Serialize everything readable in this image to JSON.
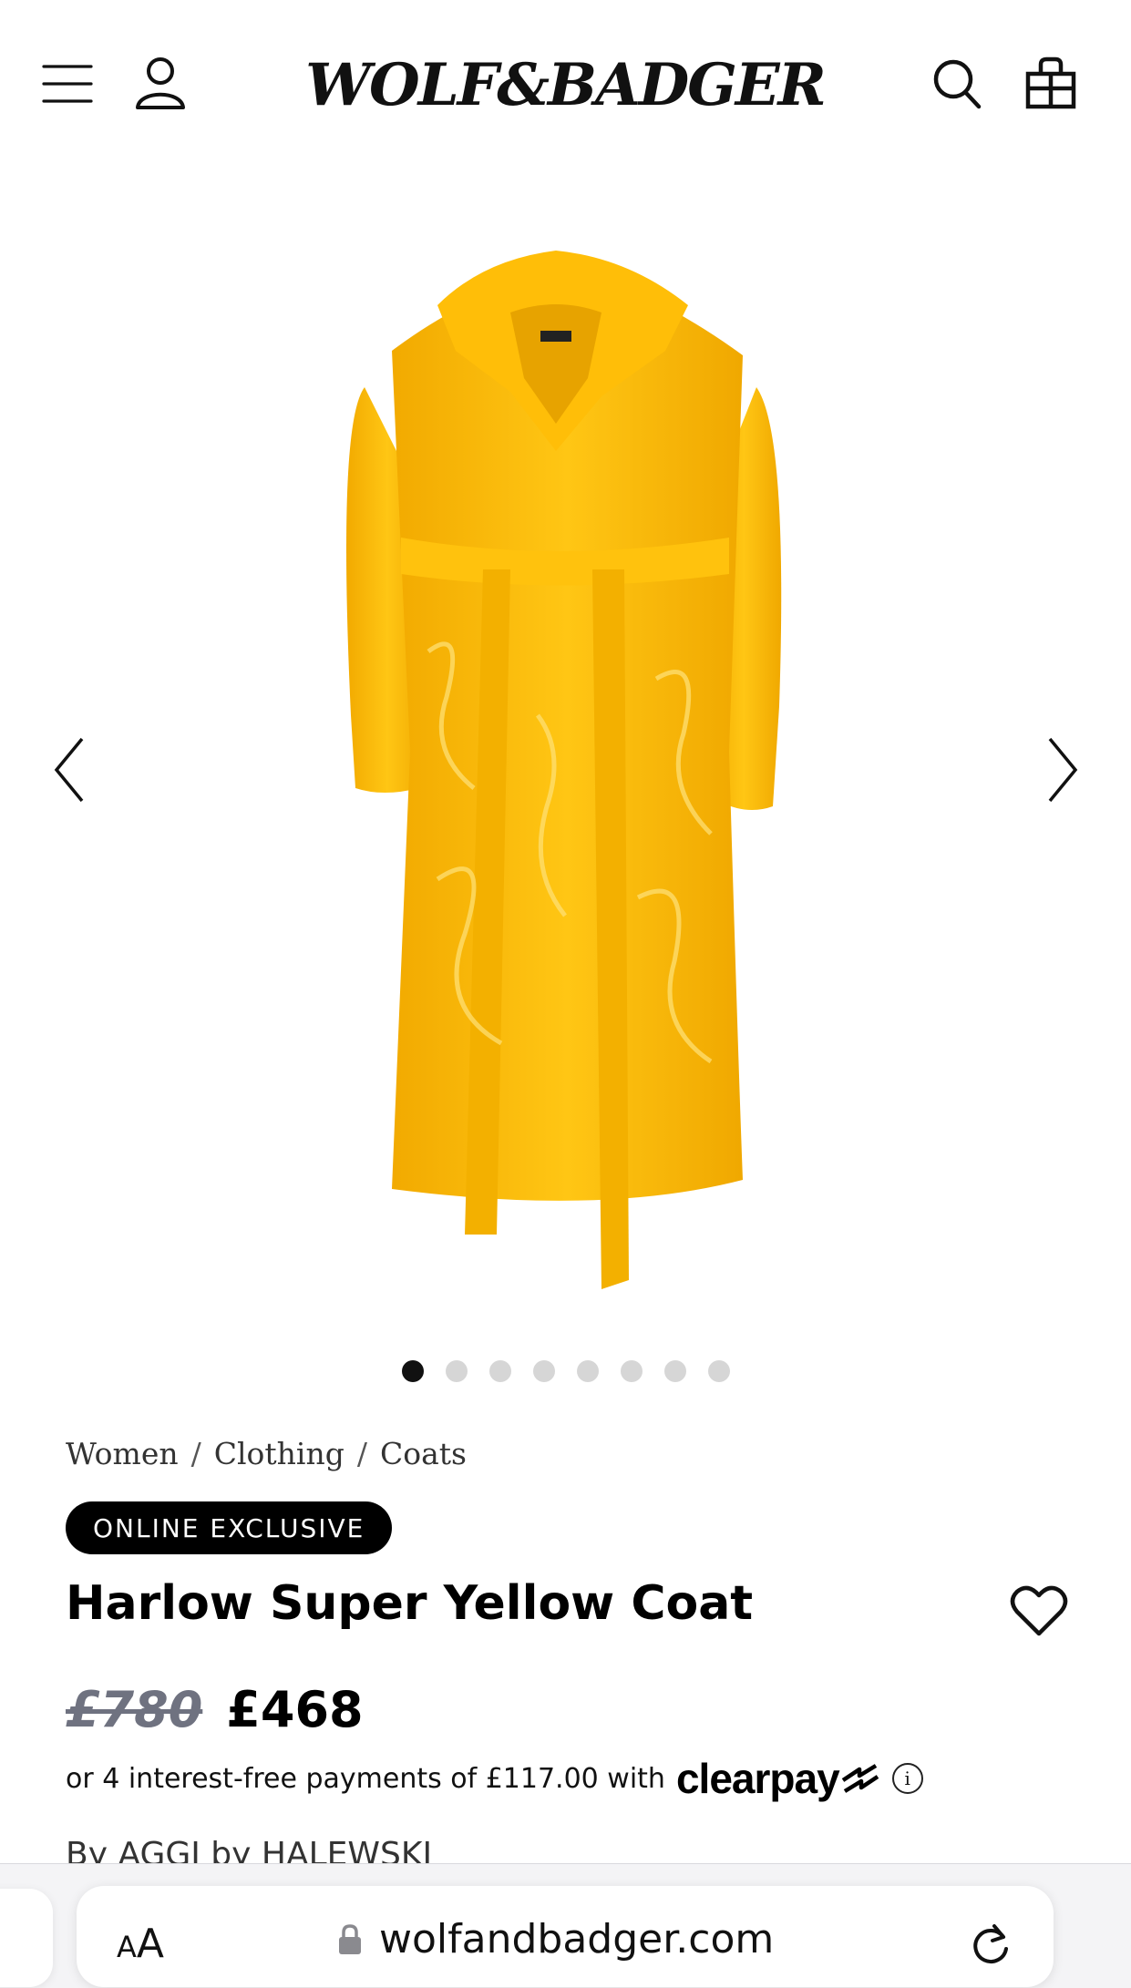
{
  "header": {
    "logo_text": "WOLF&BADGER",
    "icons": [
      "menu-icon",
      "account-icon",
      "search-icon",
      "shopping-bag-icon"
    ]
  },
  "gallery": {
    "image_alt": "Harlow Super Yellow Coat",
    "image_count": 8,
    "active_index": 0,
    "coat_color": "#f7b900"
  },
  "breadcrumb": {
    "items": [
      "Women",
      "Clothing",
      "Coats"
    ],
    "separator": "/"
  },
  "product": {
    "badge": "ONLINE EXCLUSIVE",
    "title": "Harlow Super Yellow Coat",
    "price_original": "£780",
    "price_sale": "£468",
    "payments_text": "or 4 interest-free payments of £117.00 with",
    "payments_provider": "clearpay",
    "brand_line": "By AGGI by HALEWSKI"
  },
  "browser": {
    "text_size_label_small": "A",
    "text_size_label_large": "A",
    "url": "wolfandbadger.com"
  }
}
